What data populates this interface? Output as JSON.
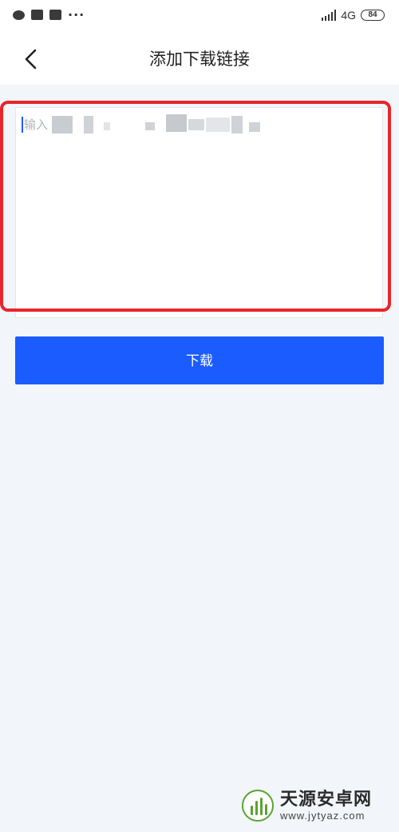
{
  "status_bar": {
    "network": "4G",
    "battery": "84",
    "more": "···"
  },
  "header": {
    "title": "添加下载链接"
  },
  "link_input": {
    "placeholder": "输入"
  },
  "actions": {
    "download_label": "下载"
  },
  "watermark": {
    "name": "天源安卓网",
    "url": "www.jytyaz.com"
  },
  "colors": {
    "accent": "#1a5cff",
    "highlight": "#e8252c",
    "background": "#f2f5f9"
  }
}
